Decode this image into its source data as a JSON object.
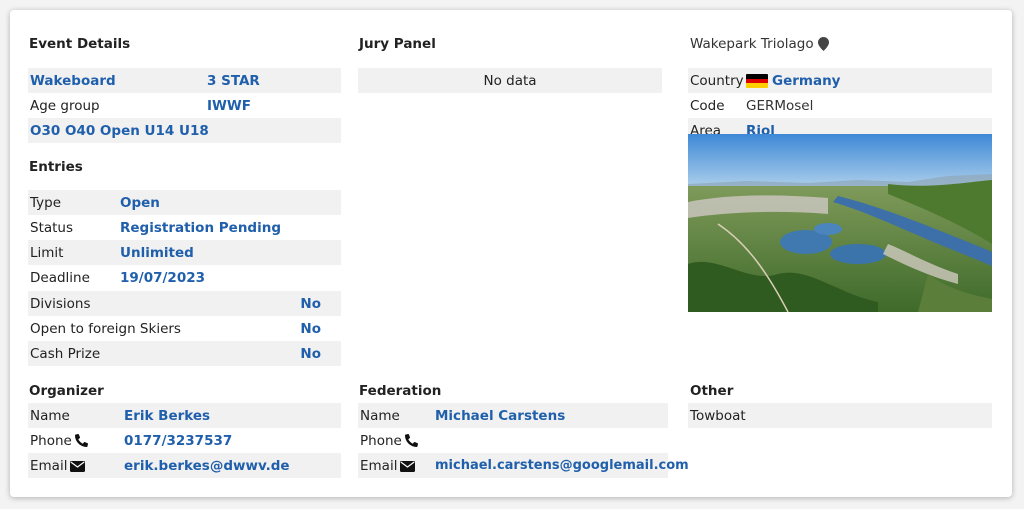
{
  "event_details": {
    "title": "Event Details",
    "discipline": "Wakeboard",
    "rating": "3 STAR",
    "age_group_label": "Age group",
    "age_group_value": "IWWF",
    "categories": "O30 O40 Open U14 U18"
  },
  "jury_panel": {
    "title": "Jury Panel",
    "empty_text": "No data"
  },
  "venue": {
    "name": "Wakepark Triolago",
    "pin_icon": "map-marker-icon",
    "country_label": "Country",
    "country_value": "Germany",
    "flag_icon": "germany-flag-icon",
    "code_label": "Code",
    "code_value": "GERMosel",
    "area_label": "Area",
    "area_value": "Riol"
  },
  "entries": {
    "title": "Entries",
    "type_label": "Type",
    "type_value": "Open",
    "status_label": "Status",
    "status_value": "Registration Pending",
    "limit_label": "Limit",
    "limit_value": "Unlimited",
    "deadline_label": "Deadline",
    "deadline_value": "19/07/2023",
    "divisions_label": "Divisions",
    "divisions_value": "No",
    "foreign_label": "Open to foreign Skiers",
    "foreign_value": "No",
    "cash_label": "Cash Prize",
    "cash_value": "No"
  },
  "organizer": {
    "title": "Organizer",
    "name_label": "Name",
    "name_value": "Erik Berkes",
    "phone_label": "Phone",
    "phone_value": "0177/3237537",
    "email_label": "Email",
    "email_value": "erik.berkes@dwwv.de"
  },
  "federation": {
    "title": "Federation",
    "name_label": "Name",
    "name_value": "Michael Carstens",
    "phone_label": "Phone",
    "phone_value": "",
    "email_label": "Email",
    "email_value": "michael.carstens@googlemail.com"
  },
  "other": {
    "title": "Other",
    "item": "Towboat"
  },
  "colors": {
    "link": "#1f5fab",
    "row_shade": "#f1f1f1"
  }
}
